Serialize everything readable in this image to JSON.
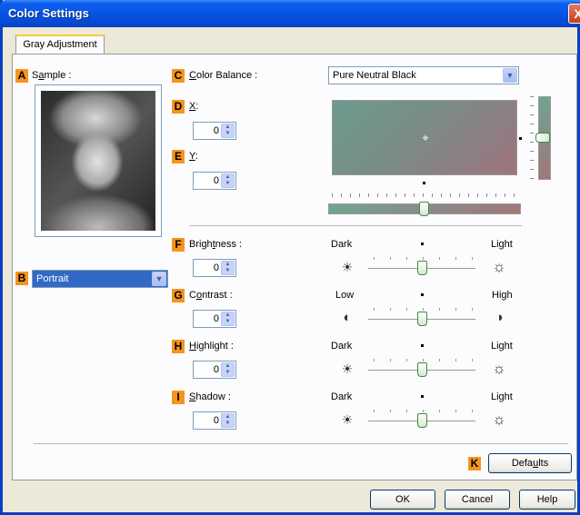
{
  "window": {
    "title": "Color Settings",
    "close_glyph": "X"
  },
  "tabs": [
    {
      "label": "Gray Adjustment"
    }
  ],
  "sample": {
    "badge": "A",
    "label_pre": "S",
    "label_ul": "a",
    "label_post": "mple :"
  },
  "orientation": {
    "badge": "B",
    "value": "Portrait"
  },
  "color_balance": {
    "badge": "C",
    "label_ul": "C",
    "label_post": "olor Balance :",
    "value": "Pure Neutral Black"
  },
  "x_field": {
    "badge": "D",
    "label_ul": "X",
    "label_post": ":",
    "value": "0"
  },
  "y_field": {
    "badge": "E",
    "label_ul": "Y",
    "label_post": ":",
    "value": "0"
  },
  "brightness": {
    "badge": "F",
    "label_pre": "Brigh",
    "label_ul": "t",
    "label_post": "ness :",
    "value": "0",
    "left": "Dark",
    "right": "Light",
    "left_icon": "sun-small-icon",
    "right_icon": "sun-large-icon",
    "level": 0.5
  },
  "contrast": {
    "badge": "G",
    "label_pre": "C",
    "label_ul": "o",
    "label_post": "ntrast :",
    "value": "0",
    "left": "Low",
    "right": "High",
    "left_icon": "contrast-low-icon",
    "right_icon": "contrast-high-icon",
    "level": 0.5
  },
  "highlight": {
    "badge": "H",
    "label_ul": "H",
    "label_post": "ighlight :",
    "value": "0",
    "left": "Dark",
    "right": "Light",
    "left_icon": "sun-small-icon",
    "right_icon": "sun-large-icon",
    "level": 0.5
  },
  "shadow": {
    "badge": "I",
    "label_ul": "S",
    "label_post": "hadow :",
    "value": "0",
    "left": "Dark",
    "right": "Light",
    "left_icon": "sun-small-icon",
    "right_icon": "sun-large-icon",
    "level": 0.5
  },
  "defaults": {
    "badge": "K",
    "label_pre": "Defa",
    "label_ul": "u",
    "label_post": "lts"
  },
  "footer": {
    "ok": "OK",
    "cancel": "Cancel",
    "help": "Help"
  },
  "colors": {
    "badge": "#f7941d",
    "titlebar": "#0853e4",
    "selection": "#316ac5"
  }
}
